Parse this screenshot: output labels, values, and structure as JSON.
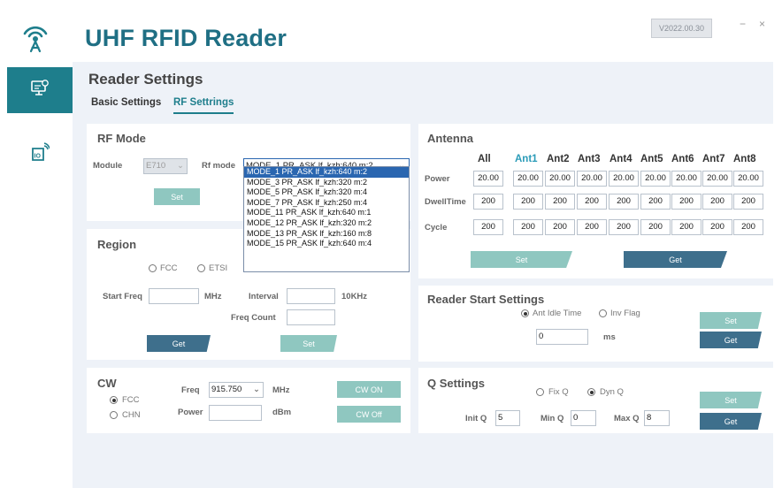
{
  "app": {
    "title": "UHF RFID Reader",
    "version": "V2022.00.30",
    "minimize": "−",
    "close": "×"
  },
  "page": {
    "title": "Reader Settings",
    "tabs": [
      "Basic Settings",
      "RF Settrings"
    ]
  },
  "rf_mode": {
    "title": "RF Mode",
    "module_label": "Module",
    "module_value": "E710",
    "mode_label": "Rf mode",
    "mode_value": "MODE_1   PR_ASK lf_kzh:640 m:2",
    "set": "Set",
    "options": [
      "MODE_1   PR_ASK lf_kzh:640 m:2",
      "MODE_3   PR_ASK lf_kzh:320 m:2",
      "MODE_5   PR_ASK lf_kzh:320 m:4",
      "MODE_7   PR_ASK lf_kzh:250 m:4",
      "MODE_11   PR_ASK lf_kzh:640 m:1",
      "MODE_12   PR_ASK lf_kzh:320 m:2",
      "MODE_13   PR_ASK lf_kzh:160 m:8",
      "MODE_15   PR_ASK lf_kzh:640 m:4"
    ]
  },
  "region": {
    "title": "Region",
    "fcc": "FCC",
    "etsi": "ETSI",
    "start_freq_label": "Start Freq",
    "mhz": "MHz",
    "interval_label": "Interval",
    "khz": "10KHz",
    "freq_count_label": "Freq Count",
    "get": "Get",
    "set": "Set"
  },
  "cw": {
    "title": "CW",
    "fcc": "FCC",
    "chn": "CHN",
    "freq_label": "Freq",
    "freq_value": "915.750",
    "mhz": "MHz",
    "power_label": "Power",
    "dbm": "dBm",
    "on": "CW ON",
    "off": "CW Off"
  },
  "antenna": {
    "title": "Antenna",
    "headers": [
      "All",
      "Ant1",
      "Ant2",
      "Ant3",
      "Ant4",
      "Ant5",
      "Ant6",
      "Ant7",
      "Ant8"
    ],
    "rows": [
      {
        "label": "Power",
        "values": [
          "20.00",
          "20.00",
          "20.00",
          "20.00",
          "20.00",
          "20.00",
          "20.00",
          "20.00",
          "20.00"
        ]
      },
      {
        "label": "DwellTime",
        "values": [
          "200",
          "200",
          "200",
          "200",
          "200",
          "200",
          "200",
          "200",
          "200"
        ]
      },
      {
        "label": "Cycle",
        "values": [
          "200",
          "200",
          "200",
          "200",
          "200",
          "200",
          "200",
          "200",
          "200"
        ]
      }
    ],
    "set": "Set",
    "get": "Get"
  },
  "start": {
    "title": "Reader Start Settings",
    "idle": "Ant Idle Time",
    "inv": "Inv Flag",
    "value": "0",
    "unit": "ms",
    "set": "Set",
    "get": "Get"
  },
  "q": {
    "title": "Q Settings",
    "fix": "Fix Q",
    "dyn": "Dyn Q",
    "init_label": "Init Q",
    "init": "5",
    "min_label": "Min Q",
    "min": "0",
    "max_label": "Max Q",
    "max": "8",
    "set": "Set",
    "get": "Get"
  }
}
